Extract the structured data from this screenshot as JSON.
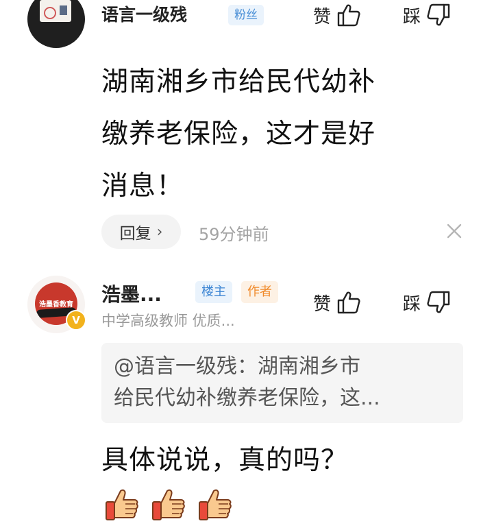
{
  "comment1": {
    "username": "语言一级残",
    "badge": "粉丝",
    "like_label": "赞",
    "dislike_label": "踩",
    "content_lines": [
      "湖南湘乡市给民代幼补",
      "缴养老保险，这才是好",
      "消息！"
    ],
    "reply_label": "回复",
    "reply_chevron": "›",
    "time": "59分钟前"
  },
  "comment2": {
    "username": "浩墨...",
    "avatar_text": "浩墨香教育",
    "verified_mark": "V",
    "badge_owner": "楼主",
    "badge_author": "作者",
    "subtitle": "中学高级教师 优质...",
    "like_label": "赞",
    "dislike_label": "踩",
    "quote_lines": [
      "@语言一级残：湖南湘乡市",
      "给民代幼补缴养老保险，这..."
    ],
    "content": "具体说说，真的吗？",
    "emoji": [
      "thumbs-up",
      "thumbs-up",
      "thumbs-up"
    ]
  },
  "colors": {
    "fan_badge": "#4a8fd6",
    "owner_badge": "#3d86d4",
    "author_badge": "#f08a2a",
    "time_text": "#a3a3a3",
    "quote_bg": "#f5f5f5",
    "verified": "#f2b21c"
  }
}
